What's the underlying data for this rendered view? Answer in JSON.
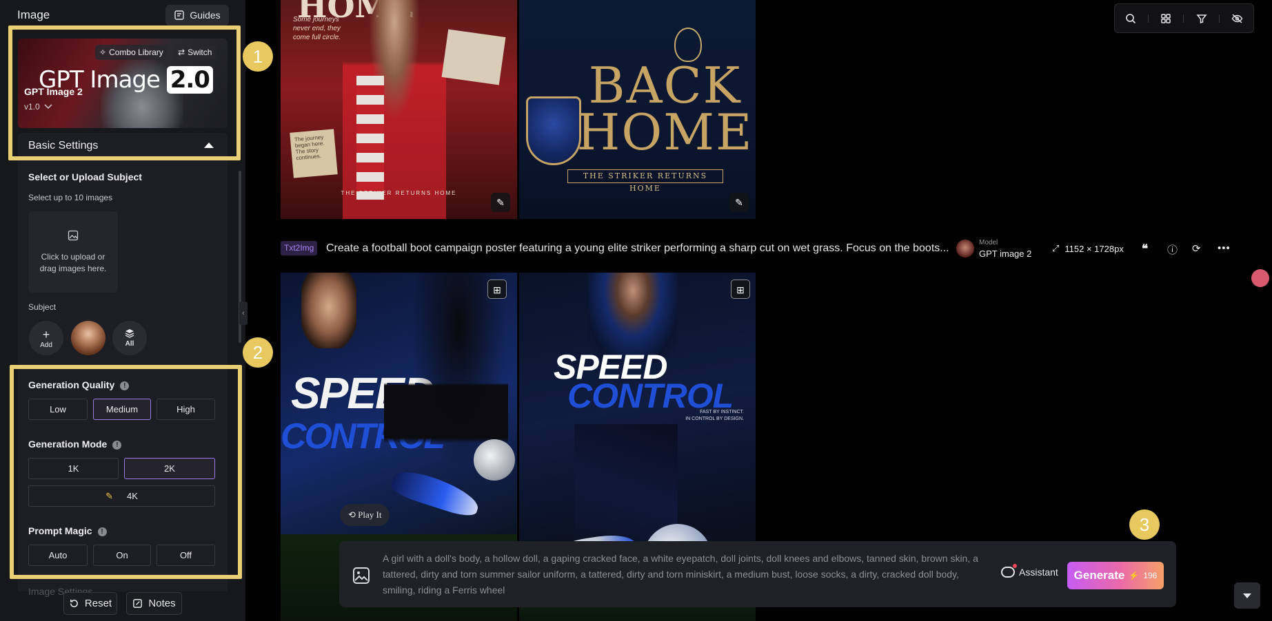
{
  "sidebar": {
    "title": "Image",
    "guides_label": "Guides",
    "model_card": {
      "brand_text": "GPT Image",
      "brand_version": "2.0",
      "combo_library_label": "Combo Library",
      "switch_label": "Switch",
      "model_name": "GPT Image 2",
      "model_version": "v1.0"
    },
    "basic_settings_label": "Basic Settings",
    "subject_section": {
      "title": "Select or Upload Subject",
      "subtitle": "Select up to 10 images",
      "upload_line1": "Click to upload or",
      "upload_line2": "drag images here.",
      "subject_label": "Subject",
      "add_label": "Add",
      "all_label": "All"
    },
    "quality": {
      "title": "Generation Quality",
      "options": [
        "Low",
        "Medium",
        "High"
      ],
      "selected": "Medium"
    },
    "mode": {
      "title": "Generation Mode",
      "options": [
        "1K",
        "2K",
        "4K"
      ],
      "selected": "2K"
    },
    "prompt_magic": {
      "title": "Prompt Magic",
      "options": [
        "Auto",
        "On",
        "Off"
      ]
    },
    "image_settings_label": "Image Settings",
    "reset_label": "Reset",
    "notes_label": "Notes"
  },
  "markers": [
    "1",
    "2",
    "3"
  ],
  "gallery": {
    "top_left": {
      "headline": "HOME",
      "script_text": "Some journeys never end, they come full circle.",
      "tagline": "THE STRIKER RETURNS HOME",
      "note_text": "The journey began here. The story continues."
    },
    "top_right": {
      "headline_1": "BACK",
      "headline_2": "HOME",
      "tagline": "THE STRIKER RETURNS HOME"
    },
    "prompt_row": {
      "tag": "Txt2Img",
      "text": "Create a football boot campaign poster featuring a young elite striker performing a sharp cut on wet grass. Focus on the boots...",
      "model_label": "Model",
      "model_value": "GPT image 2",
      "dimensions": "1152 × 1728px"
    },
    "bottom_left": {
      "word1": "SPEED",
      "word2": "CONTROL",
      "play_label": "Play It"
    },
    "bottom_right": {
      "word1": "SPEED",
      "word2": "CONTROL",
      "line1": "FAST BY INSTINCT.",
      "line2": "IN CONTROL BY DESIGN."
    }
  },
  "prompt_bar": {
    "text": "A girl with a doll's body, a hollow doll, a gaping cracked face, a white eyepatch, doll joints, doll knees and elbows, tanned skin, brown skin, a tattered, dirty and torn summer sailor uniform, a tattered, dirty and torn miniskirt, a medium bust, loose socks, a dirty, cracked doll body, smiling, riding a Ferris wheel",
    "assistant_label": "Assistant",
    "generate_label": "Generate",
    "credits": "196"
  },
  "colors": {
    "highlight": "#e9cf74",
    "accent": "#9a7be8",
    "generate_start": "#c65cf2",
    "generate_end": "#f5a068"
  }
}
